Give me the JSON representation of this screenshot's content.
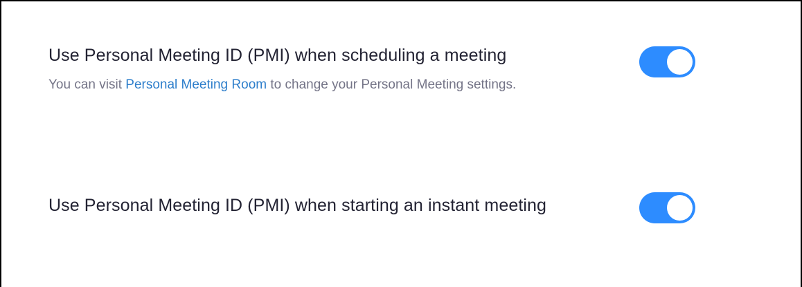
{
  "settings": [
    {
      "title": "Use Personal Meeting ID (PMI) when scheduling a meeting",
      "description_prefix": "You can visit ",
      "description_link": "Personal Meeting Room",
      "description_suffix": " to change your Personal Meeting settings.",
      "enabled": true
    },
    {
      "title": "Use Personal Meeting ID (PMI) when starting an instant meeting",
      "enabled": true
    }
  ],
  "colors": {
    "toggle_on": "#2d8cff",
    "link": "#2d7ecb",
    "title_text": "#232333",
    "description_text": "#747487"
  }
}
